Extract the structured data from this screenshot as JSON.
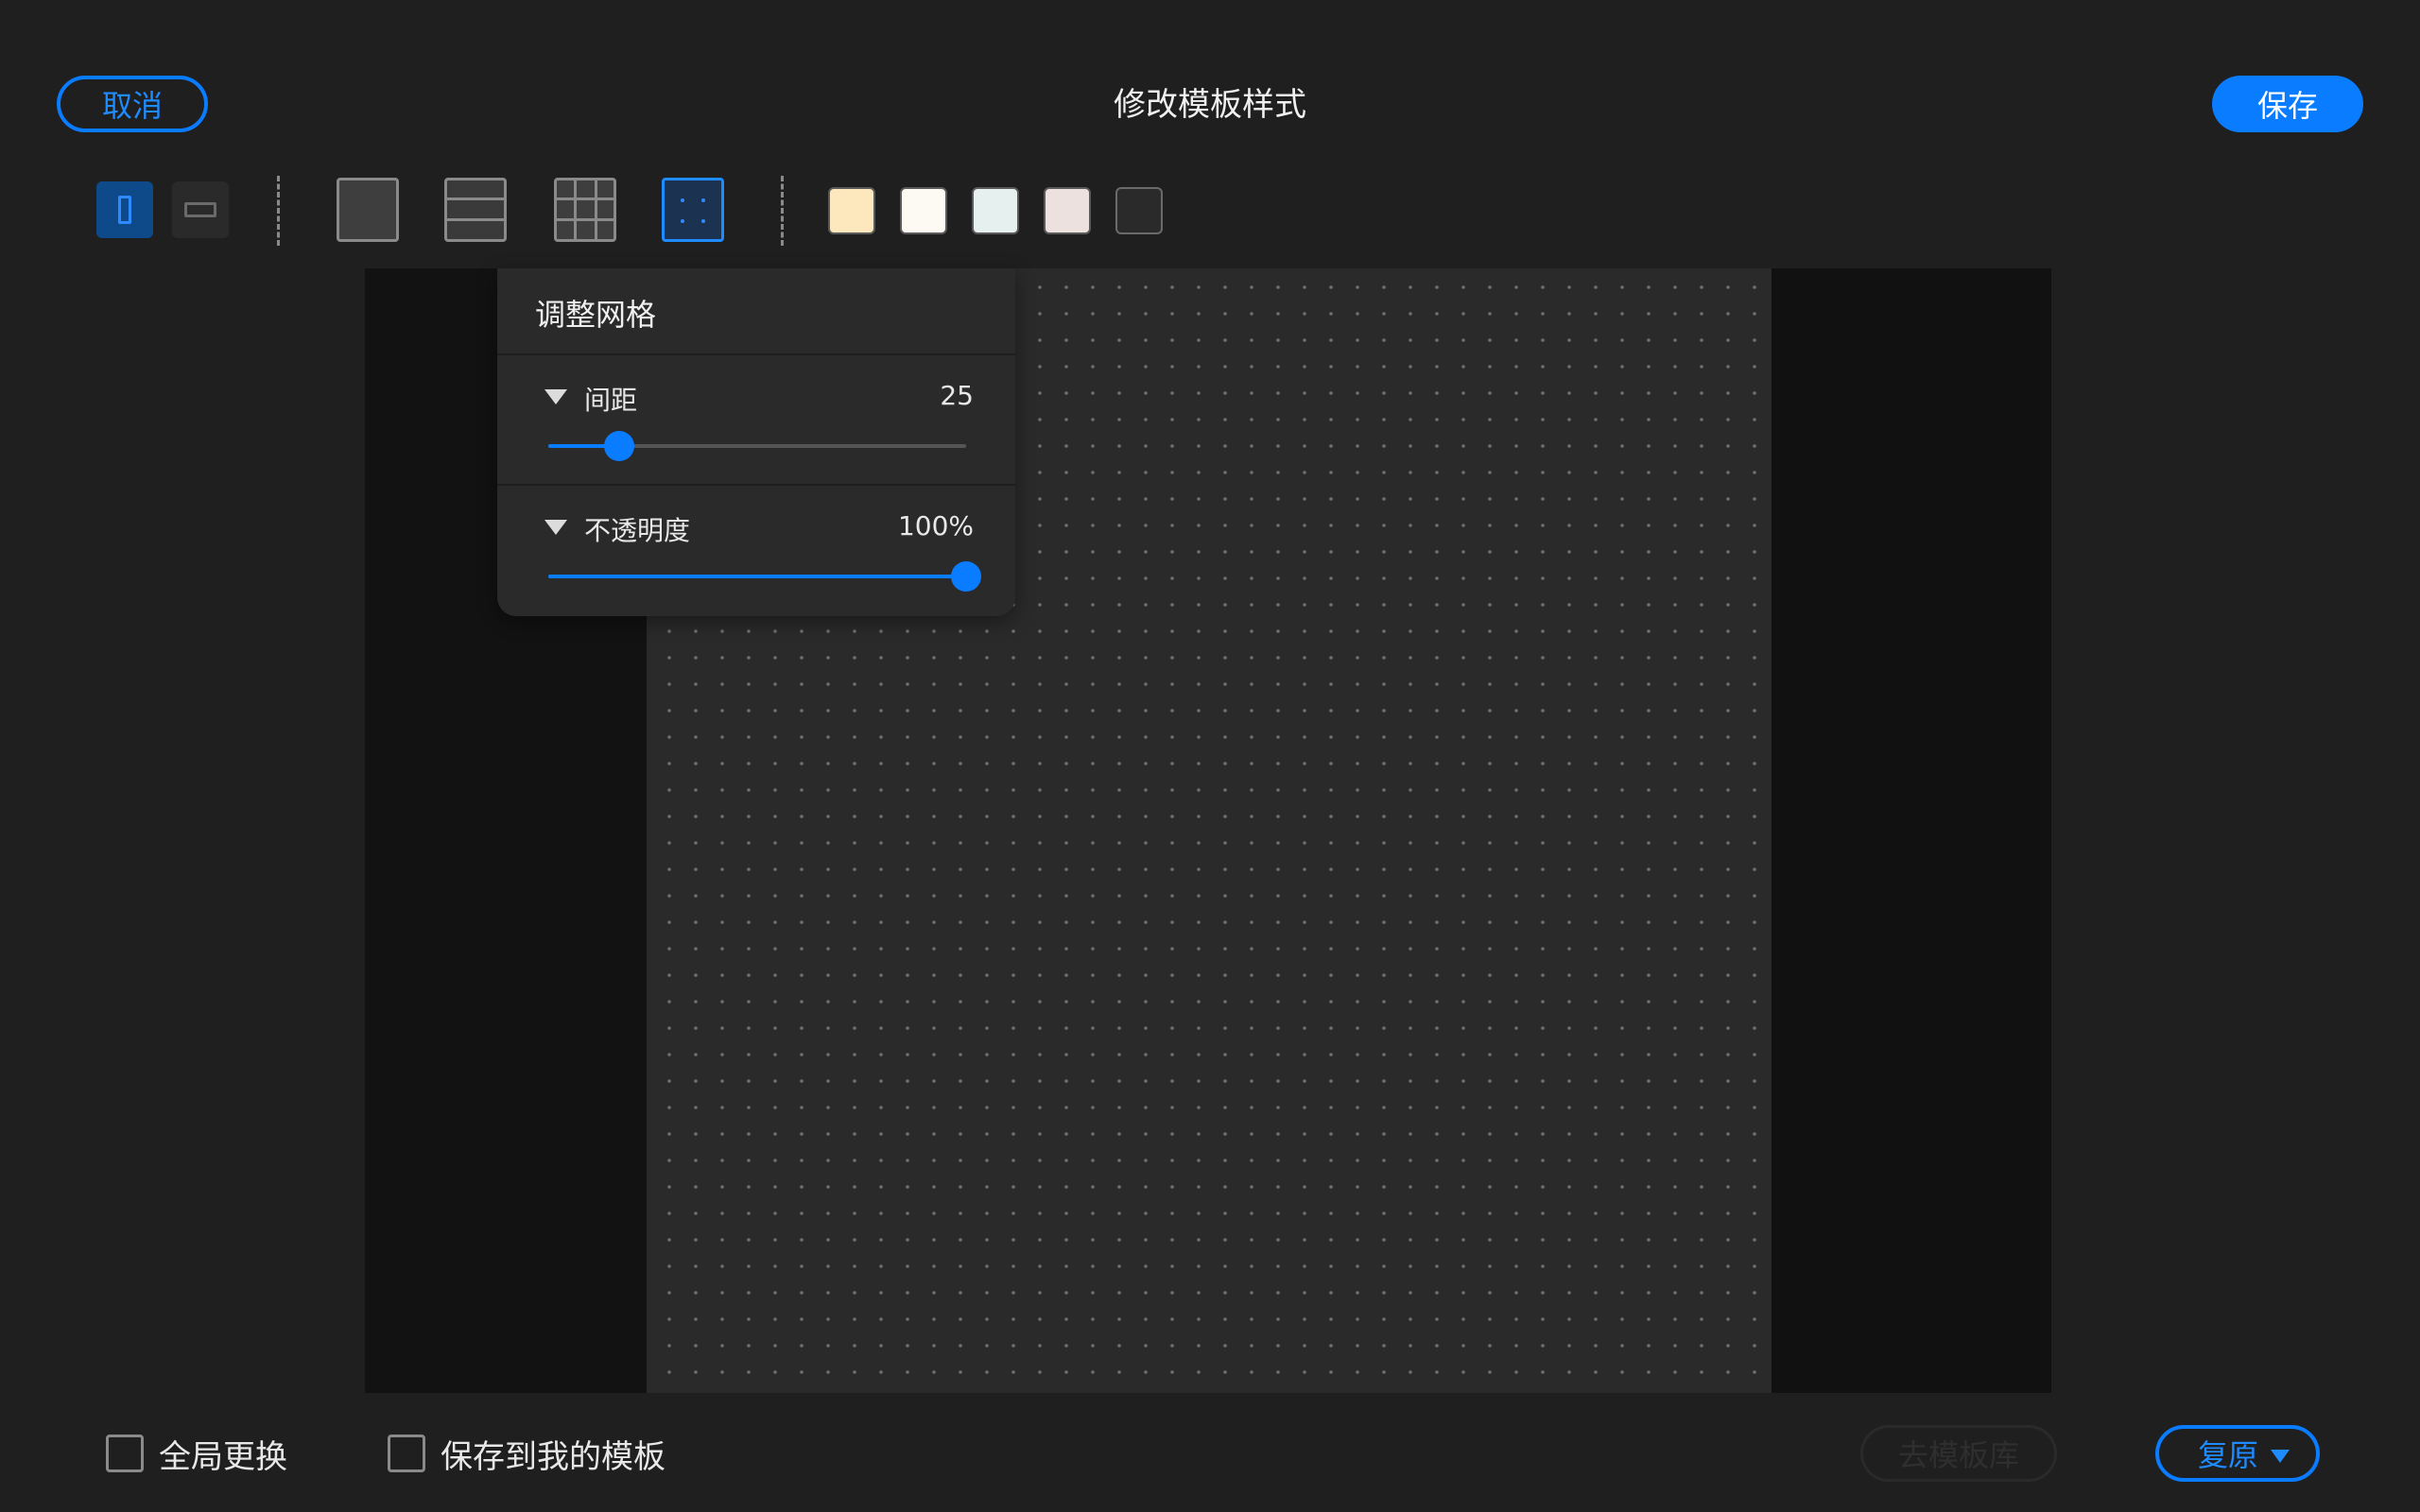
{
  "header": {
    "cancel_label": "取消",
    "title": "修改模板样式",
    "save_label": "保存"
  },
  "toolbar": {
    "orientation": [
      {
        "name": "portrait",
        "selected": true
      },
      {
        "name": "landscape",
        "selected": false
      }
    ],
    "patterns": [
      {
        "name": "blank",
        "selected": false
      },
      {
        "name": "lined",
        "selected": false
      },
      {
        "name": "grid",
        "selected": false
      },
      {
        "name": "dotted",
        "selected": true
      }
    ],
    "colors": [
      "#fde8bd",
      "#fdfaf3",
      "#e6f0ef",
      "#ede1df",
      "#2a2a2a"
    ]
  },
  "panel": {
    "title": "调整网格",
    "spacing": {
      "label": "间距",
      "value": "25",
      "fraction": 0.17
    },
    "opacity": {
      "label": "不透明度",
      "value": "100%",
      "fraction": 1.0
    }
  },
  "footer": {
    "global_replace_label": "全局更换",
    "save_to_my_templates_label": "保存到我的模板",
    "library_label": "去模板库",
    "restore_label": "复原"
  },
  "colors": {
    "accent": "#0a7cff"
  }
}
